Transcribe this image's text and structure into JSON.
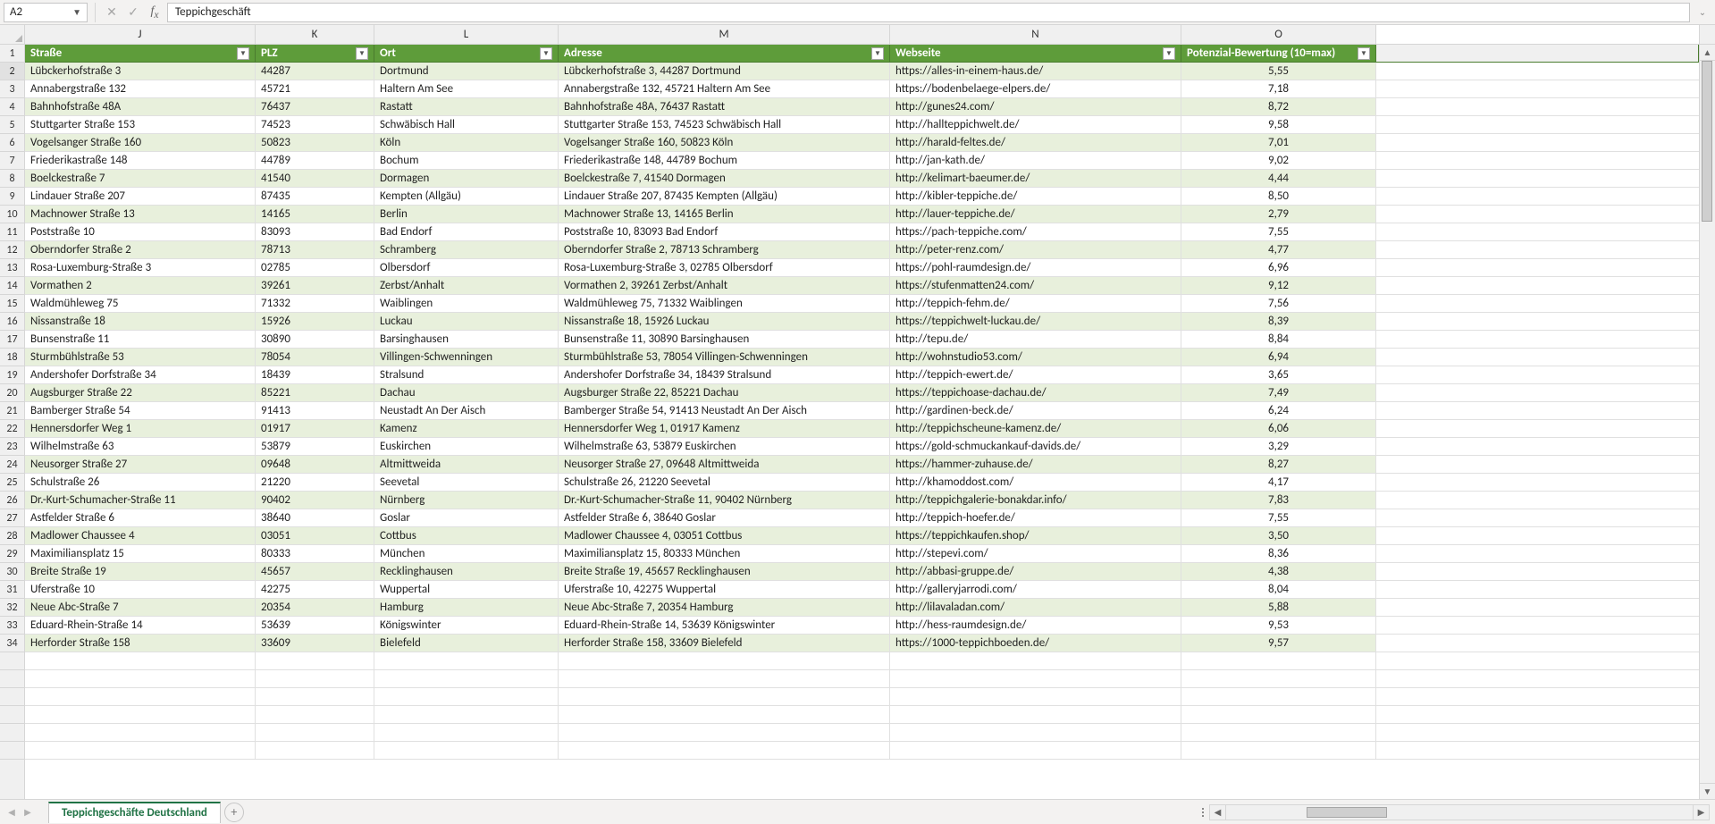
{
  "name_box": "A2",
  "formula_value": "Teppichgeschäft",
  "columns": [
    {
      "letter": "J",
      "key": "strasse",
      "label": "Straße",
      "cls": "c-J",
      "align": ""
    },
    {
      "letter": "K",
      "key": "plz",
      "label": "PLZ",
      "cls": "c-K",
      "align": ""
    },
    {
      "letter": "L",
      "key": "ort",
      "label": "Ort",
      "cls": "c-L",
      "align": ""
    },
    {
      "letter": "M",
      "key": "adresse",
      "label": "Adresse",
      "cls": "c-M",
      "align": ""
    },
    {
      "letter": "N",
      "key": "web",
      "label": "Webseite",
      "cls": "c-N",
      "align": ""
    },
    {
      "letter": "O",
      "key": "po",
      "label": "Potenzial-Bewertung (10=max)",
      "cls": "c-O",
      "align": "center"
    }
  ],
  "rows": [
    {
      "n": 2,
      "strasse": "Lübckerhofstraße 3",
      "plz": "44287",
      "ort": "Dortmund",
      "adresse": "Lübckerhofstraße 3, 44287 Dortmund",
      "web": "https://alles-in-einem-haus.de/",
      "po": "5,55"
    },
    {
      "n": 3,
      "strasse": "Annabergstraße 132",
      "plz": "45721",
      "ort": "Haltern Am See",
      "adresse": "Annabergstraße 132, 45721 Haltern Am See",
      "web": "https://bodenbelaege-elpers.de/",
      "po": "7,18"
    },
    {
      "n": 4,
      "strasse": "Bahnhofstraße 48A",
      "plz": "76437",
      "ort": "Rastatt",
      "adresse": "Bahnhofstraße 48A, 76437 Rastatt",
      "web": "http://gunes24.com/",
      "po": "8,72"
    },
    {
      "n": 5,
      "strasse": "Stuttgarter Straße 153",
      "plz": "74523",
      "ort": "Schwäbisch Hall",
      "adresse": "Stuttgarter Straße 153, 74523 Schwäbisch Hall",
      "web": "http://hallteppichwelt.de/",
      "po": "9,58"
    },
    {
      "n": 6,
      "strasse": "Vogelsanger Straße 160",
      "plz": "50823",
      "ort": "Köln",
      "adresse": "Vogelsanger Straße 160, 50823 Köln",
      "web": "http://harald-feltes.de/",
      "po": "7,01"
    },
    {
      "n": 7,
      "strasse": "Friederikastraße 148",
      "plz": "44789",
      "ort": "Bochum",
      "adresse": "Friederikastraße 148, 44789 Bochum",
      "web": "http://jan-kath.de/",
      "po": "9,02"
    },
    {
      "n": 8,
      "strasse": "Boelckestraße 7",
      "plz": "41540",
      "ort": "Dormagen",
      "adresse": "Boelckestraße 7, 41540 Dormagen",
      "web": "http://kelimart-baeumer.de/",
      "po": "4,44"
    },
    {
      "n": 9,
      "strasse": "Lindauer Straße 207",
      "plz": "87435",
      "ort": "Kempten (Allgäu)",
      "adresse": "Lindauer Straße 207, 87435 Kempten (Allgäu)",
      "web": "http://kibler-teppiche.de/",
      "po": "8,50"
    },
    {
      "n": 10,
      "strasse": "Machnower Straße 13",
      "plz": "14165",
      "ort": "Berlin",
      "adresse": "Machnower Straße 13, 14165 Berlin",
      "web": "http://lauer-teppiche.de/",
      "po": "2,79"
    },
    {
      "n": 11,
      "strasse": "Poststraße 10",
      "plz": "83093",
      "ort": "Bad Endorf",
      "adresse": "Poststraße 10, 83093 Bad Endorf",
      "web": "https://pach-teppiche.com/",
      "po": "7,55"
    },
    {
      "n": 12,
      "strasse": "Oberndorfer Straße 2",
      "plz": "78713",
      "ort": "Schramberg",
      "adresse": "Oberndorfer Straße 2, 78713 Schramberg",
      "web": "http://peter-renz.com/",
      "po": "4,77"
    },
    {
      "n": 13,
      "strasse": "Rosa-Luxemburg-Straße 3",
      "plz": "02785",
      "ort": "Olbersdorf",
      "adresse": "Rosa-Luxemburg-Straße 3, 02785 Olbersdorf",
      "web": "https://pohl-raumdesign.de/",
      "po": "6,96"
    },
    {
      "n": 14,
      "strasse": "Vormathen 2",
      "plz": "39261",
      "ort": "Zerbst/Anhalt",
      "adresse": "Vormathen 2, 39261 Zerbst/Anhalt",
      "web": "https://stufenmatten24.com/",
      "po": "9,12"
    },
    {
      "n": 15,
      "strasse": "Waldmühleweg 75",
      "plz": "71332",
      "ort": "Waiblingen",
      "adresse": "Waldmühleweg 75, 71332 Waiblingen",
      "web": "http://teppich-fehm.de/",
      "po": "7,56"
    },
    {
      "n": 16,
      "strasse": "Nissanstraße 18",
      "plz": "15926",
      "ort": "Luckau",
      "adresse": "Nissanstraße 18, 15926 Luckau",
      "web": "https://teppichwelt-luckau.de/",
      "po": "8,39"
    },
    {
      "n": 17,
      "strasse": "Bunsenstraße 11",
      "plz": "30890",
      "ort": "Barsinghausen",
      "adresse": "Bunsenstraße 11, 30890 Barsinghausen",
      "web": "http://tepu.de/",
      "po": "8,84"
    },
    {
      "n": 18,
      "strasse": "Sturmbühlstraße 53",
      "plz": "78054",
      "ort": "Villingen-Schwenningen",
      "adresse": "Sturmbühlstraße 53, 78054 Villingen-Schwenningen",
      "web": "http://wohnstudio53.com/",
      "po": "6,94"
    },
    {
      "n": 19,
      "strasse": "Andershofer Dorfstraße 34",
      "plz": "18439",
      "ort": "Stralsund",
      "adresse": "Andershofer Dorfstraße 34, 18439 Stralsund",
      "web": "http://teppich-ewert.de/",
      "po": "3,65"
    },
    {
      "n": 20,
      "strasse": "Augsburger Straße 22",
      "plz": "85221",
      "ort": "Dachau",
      "adresse": "Augsburger Straße 22, 85221 Dachau",
      "web": "https://teppichoase-dachau.de/",
      "po": "7,49"
    },
    {
      "n": 21,
      "strasse": "Bamberger Straße 54",
      "plz": "91413",
      "ort": "Neustadt An Der Aisch",
      "adresse": "Bamberger Straße 54, 91413 Neustadt An Der Aisch",
      "web": "http://gardinen-beck.de/",
      "po": "6,24"
    },
    {
      "n": 22,
      "strasse": "Hennersdorfer Weg 1",
      "plz": "01917",
      "ort": "Kamenz",
      "adresse": "Hennersdorfer Weg 1, 01917 Kamenz",
      "web": "http://teppichscheune-kamenz.de/",
      "po": "6,06"
    },
    {
      "n": 23,
      "strasse": "Wilhelmstraße 63",
      "plz": "53879",
      "ort": "Euskirchen",
      "adresse": "Wilhelmstraße 63, 53879 Euskirchen",
      "web": "https://gold-schmuckankauf-davids.de/",
      "po": "3,29"
    },
    {
      "n": 24,
      "strasse": "Neusorger Straße 27",
      "plz": "09648",
      "ort": "Altmittweida",
      "adresse": "Neusorger Straße 27, 09648 Altmittweida",
      "web": "https://hammer-zuhause.de/",
      "po": "8,27"
    },
    {
      "n": 25,
      "strasse": "Schulstraße 26",
      "plz": "21220",
      "ort": "Seevetal",
      "adresse": "Schulstraße 26, 21220 Seevetal",
      "web": "http://khamoddost.com/",
      "po": "4,17"
    },
    {
      "n": 26,
      "strasse": "Dr.-Kurt-Schumacher-Straße 11",
      "plz": "90402",
      "ort": "Nürnberg",
      "adresse": "Dr.-Kurt-Schumacher-Straße 11, 90402 Nürnberg",
      "web": "http://teppichgalerie-bonakdar.info/",
      "po": "7,83"
    },
    {
      "n": 27,
      "strasse": "Astfelder Straße 6",
      "plz": "38640",
      "ort": "Goslar",
      "adresse": "Astfelder Straße 6, 38640 Goslar",
      "web": "http://teppich-hoefer.de/",
      "po": "7,55"
    },
    {
      "n": 28,
      "strasse": "Madlower Chaussee 4",
      "plz": "03051",
      "ort": "Cottbus",
      "adresse": "Madlower Chaussee 4, 03051 Cottbus",
      "web": "https://teppichkaufen.shop/",
      "po": "3,50"
    },
    {
      "n": 29,
      "strasse": "Maximiliansplatz 15",
      "plz": "80333",
      "ort": "München",
      "adresse": "Maximiliansplatz 15, 80333 München",
      "web": "http://stepevi.com/",
      "po": "8,36"
    },
    {
      "n": 30,
      "strasse": "Breite Straße 19",
      "plz": "45657",
      "ort": "Recklinghausen",
      "adresse": "Breite Straße 19, 45657 Recklinghausen",
      "web": "http://abbasi-gruppe.de/",
      "po": "4,38"
    },
    {
      "n": 31,
      "strasse": "Uferstraße 10",
      "plz": "42275",
      "ort": "Wuppertal",
      "adresse": "Uferstraße 10, 42275 Wuppertal",
      "web": "http://galleryjarrodi.com/",
      "po": "8,04"
    },
    {
      "n": 32,
      "strasse": "Neue Abc-Straße 7",
      "plz": "20354",
      "ort": "Hamburg",
      "adresse": "Neue Abc-Straße 7, 20354 Hamburg",
      "web": "http://lilavaladan.com/",
      "po": "5,88"
    },
    {
      "n": 33,
      "strasse": "Eduard-Rhein-Straße 14",
      "plz": "53639",
      "ort": "Königswinter",
      "adresse": "Eduard-Rhein-Straße 14, 53639 Königswinter",
      "web": "http://hess-raumdesign.de/",
      "po": "9,53"
    },
    {
      "n": 34,
      "strasse": "Herforder Straße 158",
      "plz": "33609",
      "ort": "Bielefeld",
      "adresse": "Herforder Straße 158, 33609 Bielefeld",
      "web": "https://1000-teppichboeden.de/",
      "po": "9,57"
    }
  ],
  "sheet_tab": "Teppichgeschäfte Deutschland"
}
